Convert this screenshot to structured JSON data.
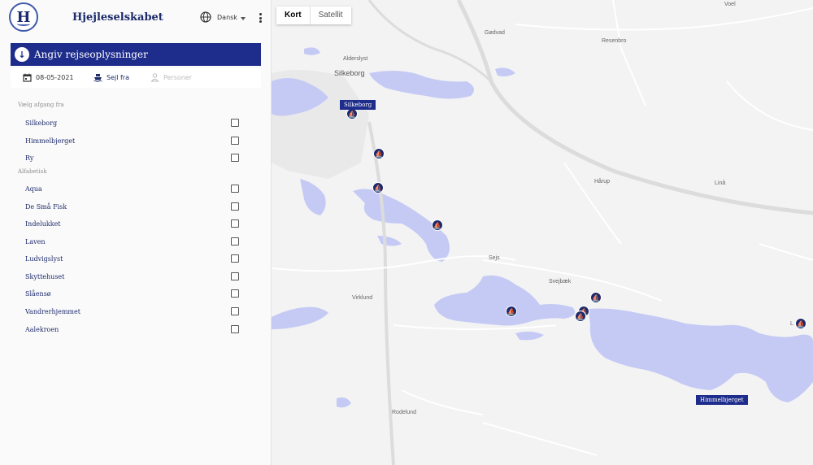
{
  "header": {
    "brand": "Hjejleselskabet",
    "logo_letter": "H",
    "language": "Dansk"
  },
  "section": {
    "title": "Angiv rejseoplysninger"
  },
  "info_bar": {
    "date": "08-05-2021",
    "sail_from": "Sejl fra",
    "persons": "Personer"
  },
  "departure_group": {
    "label": "Vælg afgang fra",
    "items": [
      "Silkeborg",
      "Himmelbjerget",
      "Ry"
    ]
  },
  "alpha_group": {
    "label": "Alfabetisk",
    "items": [
      "Aqua",
      "De Små Fisk",
      "Indelukket",
      "Laven",
      "Ludvigslyst",
      "Skyttehuset",
      "Slåensø",
      "Vandrerhjemmet",
      "Aalekroen"
    ]
  },
  "map": {
    "toggle": {
      "map": "Kort",
      "satellite": "Satellit"
    },
    "towns": [
      "Silkeborg",
      "Alderslyst",
      "Gødvad",
      "Resenbro",
      "Voel",
      "Hårup",
      "Linå",
      "Sejs",
      "Svejbæk",
      "Virklund",
      "Rodelund",
      "L"
    ],
    "tags": [
      "Silkeborg",
      "Himmelbjerget"
    ]
  },
  "colors": {
    "accent": "#1e2c8c",
    "lake": "#c5caf5",
    "road": "#ffffff"
  }
}
